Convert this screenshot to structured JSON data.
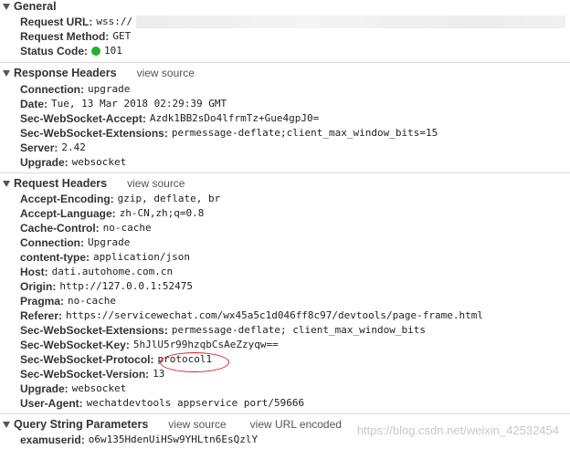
{
  "general": {
    "title": "General",
    "rows": [
      {
        "key": "Request URL:",
        "value": "wss://"
      },
      {
        "key": "Request Method:",
        "value": "GET"
      },
      {
        "key": "Status Code:",
        "value": "101"
      }
    ]
  },
  "response_headers": {
    "title": "Response Headers",
    "view_source": "view source",
    "rows": [
      {
        "key": "Connection:",
        "value": "upgrade"
      },
      {
        "key": "Date:",
        "value": "Tue, 13 Mar 2018 02:29:39 GMT"
      },
      {
        "key": "Sec-WebSocket-Accept:",
        "value": "Azdk1BB2sDo4lfrmTz+Gue4gpJ0="
      },
      {
        "key": "Sec-WebSocket-Extensions:",
        "value": "permessage-deflate;client_max_window_bits=15"
      },
      {
        "key": "Server:",
        "value": "2.42"
      },
      {
        "key": "Upgrade:",
        "value": "websocket"
      }
    ]
  },
  "request_headers": {
    "title": "Request Headers",
    "view_source": "view source",
    "rows": [
      {
        "key": "Accept-Encoding:",
        "value": "gzip, deflate, br"
      },
      {
        "key": "Accept-Language:",
        "value": "zh-CN,zh;q=0.8"
      },
      {
        "key": "Cache-Control:",
        "value": "no-cache"
      },
      {
        "key": "Connection:",
        "value": "Upgrade"
      },
      {
        "key": "content-type:",
        "value": "application/json"
      },
      {
        "key": "Host:",
        "value": "dati.autohome.com.cn"
      },
      {
        "key": "Origin:",
        "value": "http://127.0.0.1:52475"
      },
      {
        "key": "Pragma:",
        "value": "no-cache"
      },
      {
        "key": "Referer:",
        "value": "https://servicewechat.com/wx45a5c1d046ff8c97/devtools/page-frame.html"
      },
      {
        "key": "Sec-WebSocket-Extensions:",
        "value": "permessage-deflate; client_max_window_bits"
      },
      {
        "key": "Sec-WebSocket-Key:",
        "value": "5hJlU5r99hzqbCsAeZzyqw=="
      },
      {
        "key": "Sec-WebSocket-Protocol:",
        "value": "protocol1"
      },
      {
        "key": "Sec-WebSocket-Version:",
        "value": "13"
      },
      {
        "key": "Upgrade:",
        "value": "websocket"
      },
      {
        "key": "User-Agent:",
        "value": "wechatdevtools appservice port/59666"
      }
    ]
  },
  "query_string": {
    "title": "Query String Parameters",
    "view_source": "view source",
    "view_url_encoded": "view URL encoded",
    "rows": [
      {
        "key": "examuserid:",
        "value": "o6w135HdenUiHSw9YHLtn6EsQzlY"
      }
    ]
  },
  "watermark": "https://blog.csdn.net/weixin_42532454",
  "colors": {
    "status_dot": "#1eb32a",
    "annotation": "#d62020"
  },
  "icons": {
    "collapse": "triangle-down-icon"
  }
}
